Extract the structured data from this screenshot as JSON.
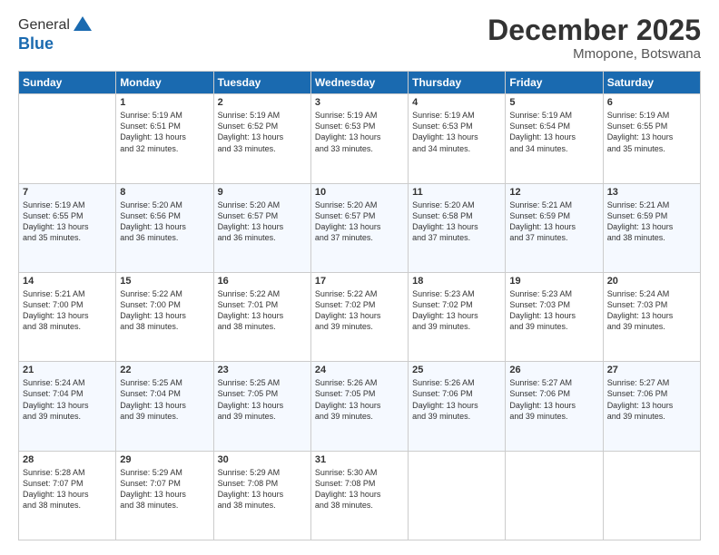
{
  "logo": {
    "line1": "General",
    "line2": "Blue"
  },
  "title": "December 2025",
  "location": "Mmopone, Botswana",
  "days_of_week": [
    "Sunday",
    "Monday",
    "Tuesday",
    "Wednesday",
    "Thursday",
    "Friday",
    "Saturday"
  ],
  "weeks": [
    [
      {
        "day": "",
        "info": ""
      },
      {
        "day": "1",
        "info": "Sunrise: 5:19 AM\nSunset: 6:51 PM\nDaylight: 13 hours\nand 32 minutes."
      },
      {
        "day": "2",
        "info": "Sunrise: 5:19 AM\nSunset: 6:52 PM\nDaylight: 13 hours\nand 33 minutes."
      },
      {
        "day": "3",
        "info": "Sunrise: 5:19 AM\nSunset: 6:53 PM\nDaylight: 13 hours\nand 33 minutes."
      },
      {
        "day": "4",
        "info": "Sunrise: 5:19 AM\nSunset: 6:53 PM\nDaylight: 13 hours\nand 34 minutes."
      },
      {
        "day": "5",
        "info": "Sunrise: 5:19 AM\nSunset: 6:54 PM\nDaylight: 13 hours\nand 34 minutes."
      },
      {
        "day": "6",
        "info": "Sunrise: 5:19 AM\nSunset: 6:55 PM\nDaylight: 13 hours\nand 35 minutes."
      }
    ],
    [
      {
        "day": "7",
        "info": "Sunrise: 5:19 AM\nSunset: 6:55 PM\nDaylight: 13 hours\nand 35 minutes."
      },
      {
        "day": "8",
        "info": "Sunrise: 5:20 AM\nSunset: 6:56 PM\nDaylight: 13 hours\nand 36 minutes."
      },
      {
        "day": "9",
        "info": "Sunrise: 5:20 AM\nSunset: 6:57 PM\nDaylight: 13 hours\nand 36 minutes."
      },
      {
        "day": "10",
        "info": "Sunrise: 5:20 AM\nSunset: 6:57 PM\nDaylight: 13 hours\nand 37 minutes."
      },
      {
        "day": "11",
        "info": "Sunrise: 5:20 AM\nSunset: 6:58 PM\nDaylight: 13 hours\nand 37 minutes."
      },
      {
        "day": "12",
        "info": "Sunrise: 5:21 AM\nSunset: 6:59 PM\nDaylight: 13 hours\nand 37 minutes."
      },
      {
        "day": "13",
        "info": "Sunrise: 5:21 AM\nSunset: 6:59 PM\nDaylight: 13 hours\nand 38 minutes."
      }
    ],
    [
      {
        "day": "14",
        "info": "Sunrise: 5:21 AM\nSunset: 7:00 PM\nDaylight: 13 hours\nand 38 minutes."
      },
      {
        "day": "15",
        "info": "Sunrise: 5:22 AM\nSunset: 7:00 PM\nDaylight: 13 hours\nand 38 minutes."
      },
      {
        "day": "16",
        "info": "Sunrise: 5:22 AM\nSunset: 7:01 PM\nDaylight: 13 hours\nand 38 minutes."
      },
      {
        "day": "17",
        "info": "Sunrise: 5:22 AM\nSunset: 7:02 PM\nDaylight: 13 hours\nand 39 minutes."
      },
      {
        "day": "18",
        "info": "Sunrise: 5:23 AM\nSunset: 7:02 PM\nDaylight: 13 hours\nand 39 minutes."
      },
      {
        "day": "19",
        "info": "Sunrise: 5:23 AM\nSunset: 7:03 PM\nDaylight: 13 hours\nand 39 minutes."
      },
      {
        "day": "20",
        "info": "Sunrise: 5:24 AM\nSunset: 7:03 PM\nDaylight: 13 hours\nand 39 minutes."
      }
    ],
    [
      {
        "day": "21",
        "info": "Sunrise: 5:24 AM\nSunset: 7:04 PM\nDaylight: 13 hours\nand 39 minutes."
      },
      {
        "day": "22",
        "info": "Sunrise: 5:25 AM\nSunset: 7:04 PM\nDaylight: 13 hours\nand 39 minutes."
      },
      {
        "day": "23",
        "info": "Sunrise: 5:25 AM\nSunset: 7:05 PM\nDaylight: 13 hours\nand 39 minutes."
      },
      {
        "day": "24",
        "info": "Sunrise: 5:26 AM\nSunset: 7:05 PM\nDaylight: 13 hours\nand 39 minutes."
      },
      {
        "day": "25",
        "info": "Sunrise: 5:26 AM\nSunset: 7:06 PM\nDaylight: 13 hours\nand 39 minutes."
      },
      {
        "day": "26",
        "info": "Sunrise: 5:27 AM\nSunset: 7:06 PM\nDaylight: 13 hours\nand 39 minutes."
      },
      {
        "day": "27",
        "info": "Sunrise: 5:27 AM\nSunset: 7:06 PM\nDaylight: 13 hours\nand 39 minutes."
      }
    ],
    [
      {
        "day": "28",
        "info": "Sunrise: 5:28 AM\nSunset: 7:07 PM\nDaylight: 13 hours\nand 38 minutes."
      },
      {
        "day": "29",
        "info": "Sunrise: 5:29 AM\nSunset: 7:07 PM\nDaylight: 13 hours\nand 38 minutes."
      },
      {
        "day": "30",
        "info": "Sunrise: 5:29 AM\nSunset: 7:08 PM\nDaylight: 13 hours\nand 38 minutes."
      },
      {
        "day": "31",
        "info": "Sunrise: 5:30 AM\nSunset: 7:08 PM\nDaylight: 13 hours\nand 38 minutes."
      },
      {
        "day": "",
        "info": ""
      },
      {
        "day": "",
        "info": ""
      },
      {
        "day": "",
        "info": ""
      }
    ]
  ]
}
